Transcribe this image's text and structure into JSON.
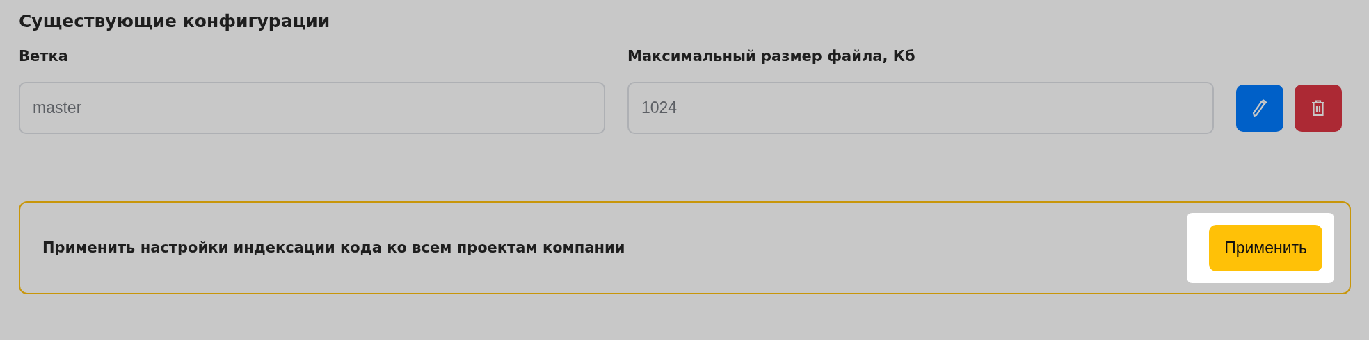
{
  "title": "Существующие конфигурации",
  "columns": [
    "Ветка",
    "Максимальный размер файла, Кб"
  ],
  "configs": [
    {
      "branch": "master",
      "max_size": "1024",
      "disabled": true
    }
  ],
  "apply_panel": {
    "text": "Применить настройки индексации кода ко всем проектам компании",
    "button": "Применить",
    "highlighted": true
  }
}
